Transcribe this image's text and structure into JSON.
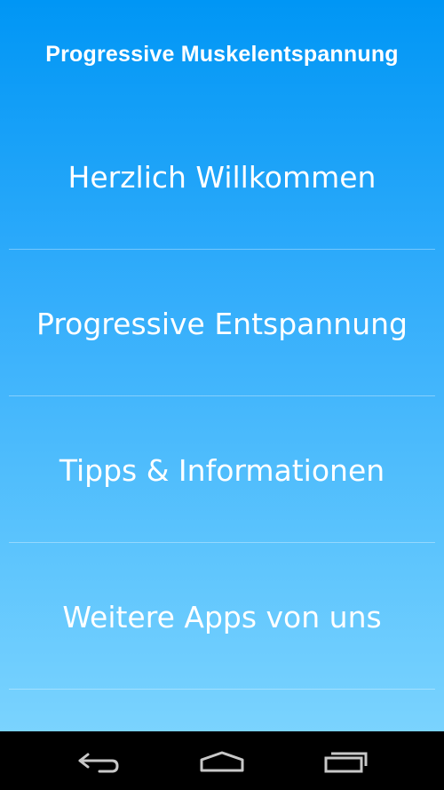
{
  "app": {
    "title": "Progressive Muskelentspannung"
  },
  "menu": {
    "items": [
      {
        "label": "Herzlich Willkommen"
      },
      {
        "label": "Progressive Entspannung"
      },
      {
        "label": "Tipps & Informationen"
      },
      {
        "label": "Weitere Apps von uns"
      }
    ]
  },
  "navbar": {
    "buttons": [
      {
        "icon": "back-icon"
      },
      {
        "icon": "home-icon"
      },
      {
        "icon": "recent-apps-icon"
      }
    ]
  },
  "colors": {
    "gradient_top": "#0096f5",
    "gradient_bottom": "#7ad3fe",
    "text": "#ffffff",
    "navbar": "#000000"
  }
}
